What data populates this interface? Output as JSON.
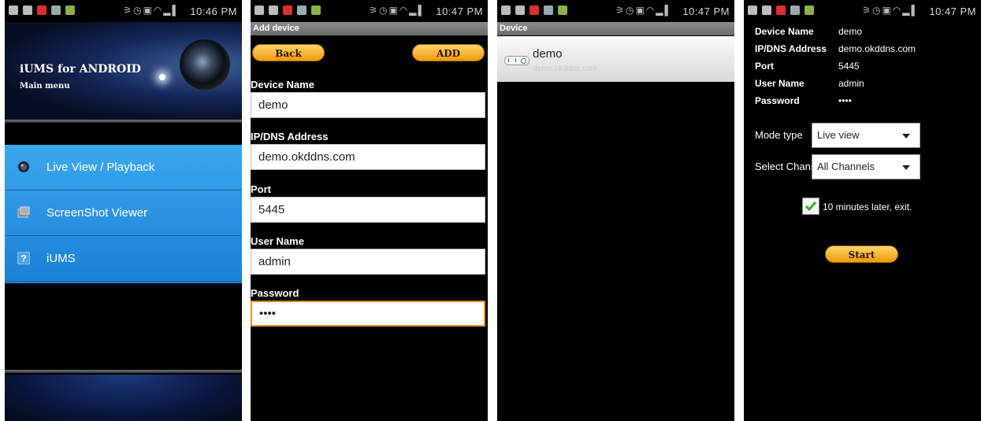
{
  "status": [
    {
      "time": "10:46 PM"
    },
    {
      "time": "10:47 PM"
    },
    {
      "time": "10:47 PM"
    },
    {
      "time": "10:47 PM"
    }
  ],
  "main_menu": {
    "app_title": "iUMS for ANDROID",
    "subtitle": "Main menu",
    "items": [
      {
        "label": "Live View / Playback",
        "icon": "lens-icon"
      },
      {
        "label": "ScreenShot Viewer",
        "icon": "screenshot-icon"
      },
      {
        "label": "iUMS",
        "icon": "help-icon"
      }
    ]
  },
  "add_device": {
    "title": "Add device",
    "back_label": "Back",
    "add_label": "ADD",
    "fields": [
      {
        "label": "Device Name",
        "value": "demo"
      },
      {
        "label": "IP/DNS Address",
        "value": "demo.okddns.com"
      },
      {
        "label": "Port",
        "value": "5445"
      },
      {
        "label": "User Name",
        "value": "admin"
      },
      {
        "label": "Password",
        "value": "••••"
      }
    ]
  },
  "device_list": {
    "title": "Device",
    "devices": [
      {
        "name": "demo",
        "address": "demo.okddns.com"
      }
    ]
  },
  "device_detail": {
    "info": [
      {
        "label": "Device Name",
        "value": "demo"
      },
      {
        "label": "IP/DNS Address",
        "value": "demo.okddns.com"
      },
      {
        "label": "Port",
        "value": "5445"
      },
      {
        "label": "User Name",
        "value": "admin"
      },
      {
        "label": "Password",
        "value": "••••"
      }
    ],
    "mode_type_label": "Mode type",
    "mode_type_value": "Live view",
    "select_channel_label": "Select Chann",
    "select_channel_value": "All Channels",
    "exit_checkbox_label": "10 minutes later, exit.",
    "exit_checked": true,
    "start_label": "Start"
  }
}
